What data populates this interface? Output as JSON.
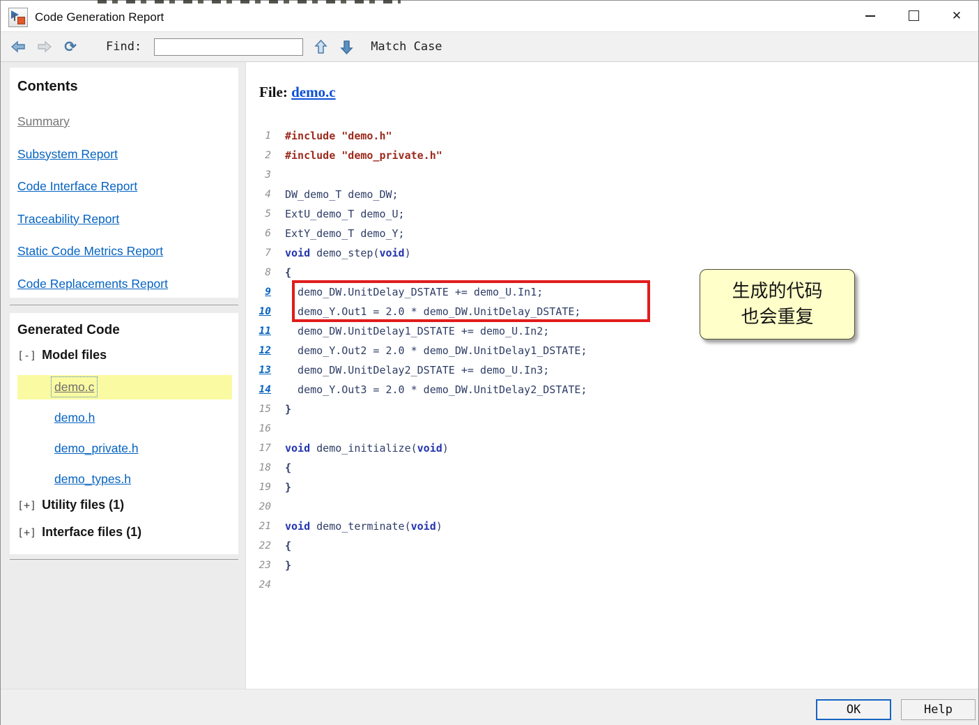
{
  "window": {
    "title": "Code Generation Report",
    "controls": {
      "minimize": "",
      "maximize": "",
      "close": "✕"
    }
  },
  "toolbar": {
    "find_label": "Find:",
    "find_value": "",
    "match_case_label": "Match Case",
    "icons": [
      "back-icon",
      "forward-icon",
      "refresh-icon",
      "find-previous-icon",
      "find-next-icon"
    ]
  },
  "sidebar": {
    "contents": {
      "heading": "Contents",
      "items": [
        {
          "label": "Summary",
          "visited": true
        },
        {
          "label": "Subsystem Report",
          "visited": false
        },
        {
          "label": "Code Interface Report",
          "visited": false
        },
        {
          "label": "Traceability Report",
          "visited": false
        },
        {
          "label": "Static Code Metrics Report",
          "visited": false
        },
        {
          "label": "Code Replacements Report",
          "visited": false
        }
      ]
    },
    "generated_code": {
      "heading": "Generated Code",
      "groups": [
        {
          "toggle": "[-]",
          "label": "Model files",
          "files": [
            {
              "name": "demo.c",
              "selected": true
            },
            {
              "name": "demo.h",
              "selected": false
            },
            {
              "name": "demo_private.h",
              "selected": false
            },
            {
              "name": "demo_types.h",
              "selected": false
            }
          ]
        },
        {
          "toggle": "[+]",
          "label": "Utility files (1)",
          "files": []
        },
        {
          "toggle": "[+]",
          "label": "Interface files (1)",
          "files": []
        }
      ]
    }
  },
  "main": {
    "file_label": "File:",
    "file_name": "demo.c",
    "code_lines": [
      {
        "n": "1",
        "link": false,
        "segs": [
          {
            "c": "pp",
            "t": "#include \"demo.h\""
          }
        ]
      },
      {
        "n": "2",
        "link": false,
        "segs": [
          {
            "c": "pp",
            "t": "#include \"demo_private.h\""
          }
        ]
      },
      {
        "n": "3",
        "link": false,
        "segs": []
      },
      {
        "n": "4",
        "link": false,
        "segs": [
          {
            "c": "pl",
            "t": "DW_demo_T demo_DW;"
          }
        ]
      },
      {
        "n": "5",
        "link": false,
        "segs": [
          {
            "c": "pl",
            "t": "ExtU_demo_T demo_U;"
          }
        ]
      },
      {
        "n": "6",
        "link": false,
        "segs": [
          {
            "c": "pl",
            "t": "ExtY_demo_T demo_Y;"
          }
        ]
      },
      {
        "n": "7",
        "link": false,
        "segs": [
          {
            "c": "kw",
            "t": "void"
          },
          {
            "c": "pl",
            "t": " demo_step("
          },
          {
            "c": "kw",
            "t": "void"
          },
          {
            "c": "pl",
            "t": ")"
          }
        ]
      },
      {
        "n": "8",
        "link": false,
        "segs": [
          {
            "c": "br",
            "t": "{"
          }
        ]
      },
      {
        "n": "9",
        "link": true,
        "segs": [
          {
            "c": "pl",
            "t": "  demo_DW.UnitDelay_DSTATE += demo_U.In1;"
          }
        ]
      },
      {
        "n": "10",
        "link": true,
        "segs": [
          {
            "c": "pl",
            "t": "  demo_Y.Out1 = 2.0 * demo_DW.UnitDelay_DSTATE;"
          }
        ]
      },
      {
        "n": "11",
        "link": true,
        "segs": [
          {
            "c": "pl",
            "t": "  demo_DW.UnitDelay1_DSTATE += demo_U.In2;"
          }
        ]
      },
      {
        "n": "12",
        "link": true,
        "segs": [
          {
            "c": "pl",
            "t": "  demo_Y.Out2 = 2.0 * demo_DW.UnitDelay1_DSTATE;"
          }
        ]
      },
      {
        "n": "13",
        "link": true,
        "segs": [
          {
            "c": "pl",
            "t": "  demo_DW.UnitDelay2_DSTATE += demo_U.In3;"
          }
        ]
      },
      {
        "n": "14",
        "link": true,
        "segs": [
          {
            "c": "pl",
            "t": "  demo_Y.Out3 = 2.0 * demo_DW.UnitDelay2_DSTATE;"
          }
        ]
      },
      {
        "n": "15",
        "link": false,
        "segs": [
          {
            "c": "br",
            "t": "}"
          }
        ]
      },
      {
        "n": "16",
        "link": false,
        "segs": []
      },
      {
        "n": "17",
        "link": false,
        "segs": [
          {
            "c": "kw",
            "t": "void"
          },
          {
            "c": "pl",
            "t": " demo_initialize("
          },
          {
            "c": "kw",
            "t": "void"
          },
          {
            "c": "pl",
            "t": ")"
          }
        ]
      },
      {
        "n": "18",
        "link": false,
        "segs": [
          {
            "c": "br",
            "t": "{"
          }
        ]
      },
      {
        "n": "19",
        "link": false,
        "segs": [
          {
            "c": "br",
            "t": "}"
          }
        ]
      },
      {
        "n": "20",
        "link": false,
        "segs": []
      },
      {
        "n": "21",
        "link": false,
        "segs": [
          {
            "c": "kw",
            "t": "void"
          },
          {
            "c": "pl",
            "t": " demo_terminate("
          },
          {
            "c": "kw",
            "t": "void"
          },
          {
            "c": "pl",
            "t": ")"
          }
        ]
      },
      {
        "n": "22",
        "link": false,
        "segs": [
          {
            "c": "br",
            "t": "{"
          }
        ]
      },
      {
        "n": "23",
        "link": false,
        "segs": [
          {
            "c": "br",
            "t": "}"
          }
        ]
      },
      {
        "n": "24",
        "link": false,
        "segs": []
      }
    ]
  },
  "annotation": {
    "line1": "生成的代码",
    "line2": "也会重复"
  },
  "footer": {
    "ok_label": "OK",
    "help_label": "Help"
  },
  "colors": {
    "link_blue": "#0563c1",
    "visited_gray": "#757575",
    "code_plain": "#2e3d66",
    "code_keyword": "#2333b0",
    "code_preprocessor": "#9c2a1d",
    "highlight_yellow": "#fafaa2",
    "note_yellow": "#ffffc9",
    "red_box": "#e11c1c",
    "ok_border_blue": "#1665c1"
  }
}
